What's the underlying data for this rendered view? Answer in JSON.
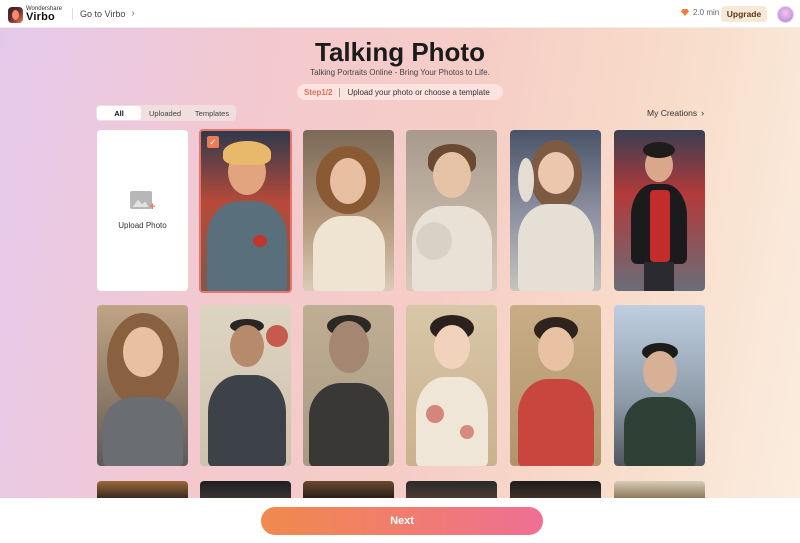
{
  "topbar": {
    "brand_small": "Wondershare",
    "brand_big": "Virbo",
    "goto_label": "Go to Virbo",
    "credits": "2.0 min",
    "upgrade_label": "Upgrade"
  },
  "header": {
    "title": "Talking Photo",
    "subtitle": "Talking Portraits Online - Bring Your Photos to Life.",
    "step_num": "Step1/2",
    "step_text": "Upload your photo or choose a template"
  },
  "tabs": [
    "All",
    "Uploaded",
    "Templates"
  ],
  "my_creations_label": "My Creations",
  "upload_label": "Upload Photo",
  "next_label": "Next",
  "colors": {
    "accent": "#ec7b58",
    "next_start": "#f08a4c",
    "next_end": "#ef6f94"
  }
}
